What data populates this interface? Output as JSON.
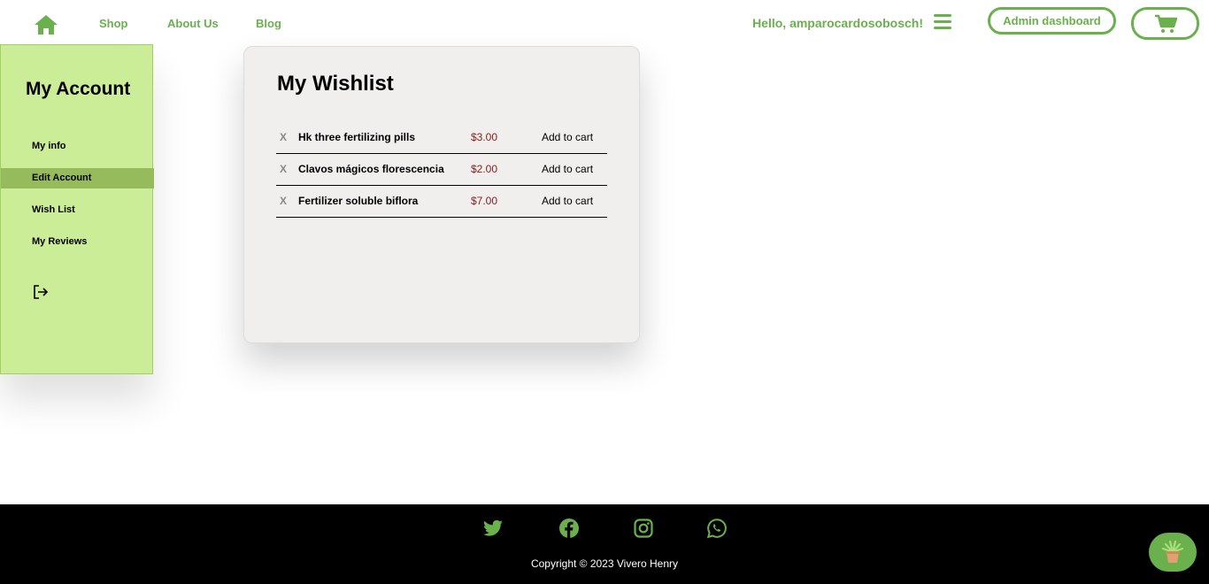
{
  "navbar": {
    "links": [
      {
        "label": "Shop"
      },
      {
        "label": "About Us"
      },
      {
        "label": "Blog"
      }
    ],
    "greeting": "Hello, amparocardosobosch!",
    "admin_button": "Admin dashboard",
    "icons": {
      "home": "home-icon",
      "menu": "hamburger-menu-icon",
      "cart": "shopping-cart-icon"
    },
    "accent_color": "#6ab04c"
  },
  "sidebar": {
    "title": "My Account",
    "items": [
      {
        "label": "My info"
      },
      {
        "label": "Edit Account",
        "active": true
      },
      {
        "label": "Wish List"
      },
      {
        "label": "My Reviews"
      }
    ],
    "logout_icon": "logout-icon",
    "background": "#cbed97",
    "active_background": "#96bb5c"
  },
  "wishlist": {
    "title": "My Wishlist",
    "remove_label": "X",
    "add_to_cart_label": "Add to cart",
    "items": [
      {
        "name": "Hk three fertilizing pills",
        "price": "$3.00"
      },
      {
        "name": "Clavos mágicos florescencia",
        "price": "$2.00"
      },
      {
        "name": "Fertilizer soluble biflora",
        "price": "$7.00"
      }
    ]
  },
  "footer": {
    "social_icons": [
      "twitter-icon",
      "facebook-icon",
      "instagram-icon",
      "whatsapp-icon"
    ],
    "copyright": "Copyright © 2023 Vivero Henry",
    "floating_button_icon": "plant-pot-icon"
  }
}
